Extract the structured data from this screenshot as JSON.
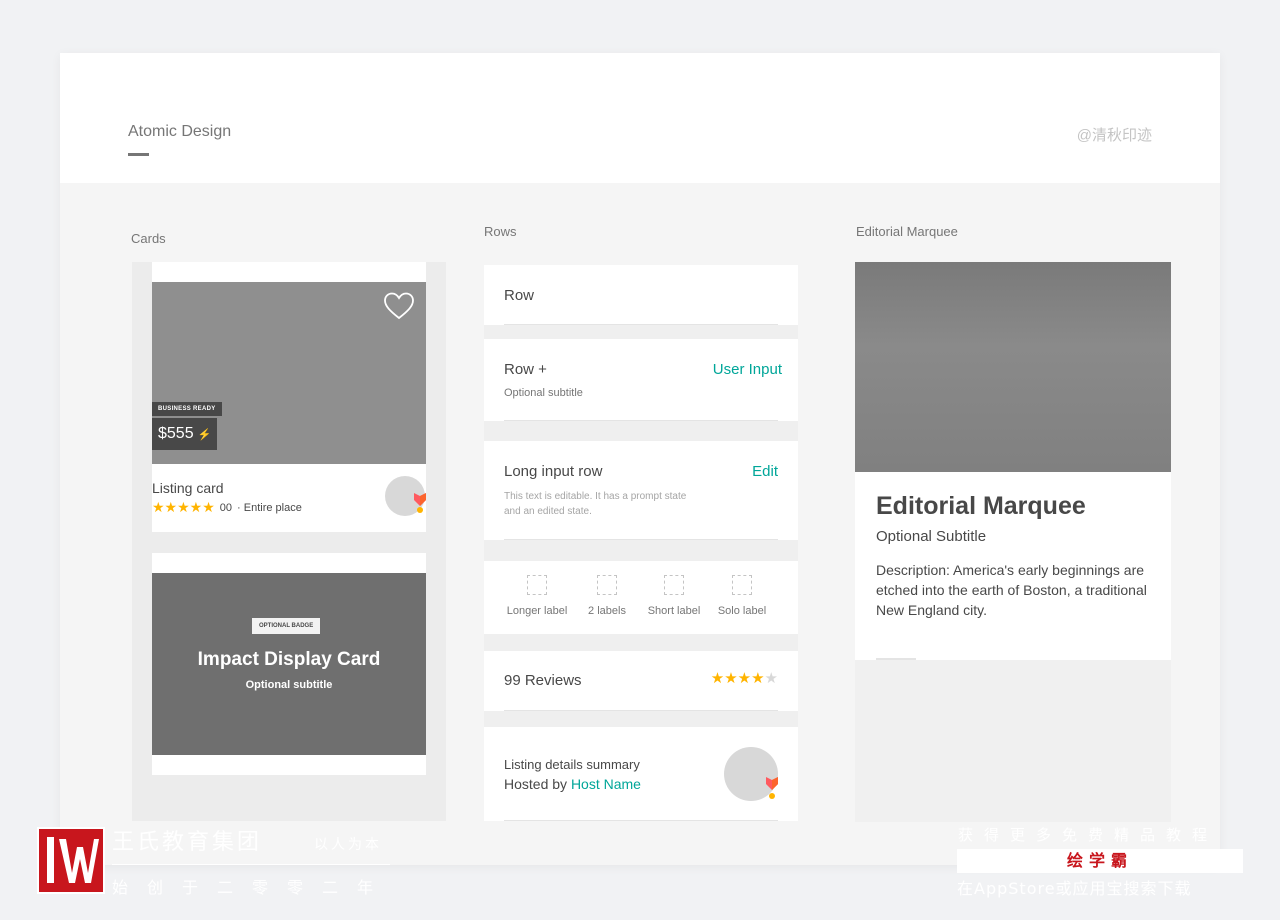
{
  "header": {
    "title": "Atomic Design",
    "author": "@清秋印迹"
  },
  "sections": {
    "cards": "Cards",
    "rows": "Rows",
    "editorial": "Editorial Marquee"
  },
  "listing_card": {
    "badge": "BUSINESS READY",
    "price": "$555",
    "title": "Listing card",
    "stars": "★★★★★",
    "rating_count": "00",
    "meta": "· Entire place"
  },
  "impact_card": {
    "badge": "OPTIONAL BADGE",
    "title": "Impact Display Card",
    "subtitle": "Optional subtitle"
  },
  "rows": {
    "row1": {
      "title": "Row"
    },
    "row2": {
      "title": "Row +",
      "subtitle": "Optional subtitle",
      "action": "User Input"
    },
    "row3": {
      "title": "Long input row",
      "action": "Edit",
      "description": "This text is editable. It has a prompt state and an edited state."
    },
    "checkboxes": [
      "Longer label",
      "2 labels",
      "Short label",
      "Solo label"
    ],
    "reviews": {
      "title": "99 Reviews",
      "rating": 4,
      "max": 5
    },
    "summary": {
      "title": "Listing details summary",
      "hosted_by": "Hosted by",
      "host_name": "Host Name"
    }
  },
  "editorial": {
    "title": "Editorial Marquee",
    "subtitle": "Optional Subtitle",
    "description": "Description: America's early beginnings are etched into the earth of Boston, a traditional New England city."
  },
  "watermark": {
    "org": "王氏教育集团",
    "slogan": "以人为本",
    "since": "始创于二零零二年",
    "free": "获得更多免费精品教程",
    "brand": "绘学霸",
    "search": "在AppStore或应用宝搜索下载"
  },
  "colors": {
    "accent": "#00a699",
    "star": "#ffb400",
    "text": "#484848",
    "watermark_red": "#c8161d"
  }
}
